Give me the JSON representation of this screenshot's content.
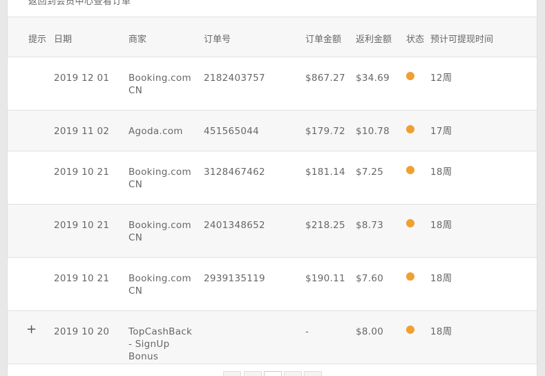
{
  "top_caption": "返回到会员中心查看订单",
  "table": {
    "headers": {
      "hint": "提示",
      "date": "日期",
      "merchant": "商家",
      "order": "订单号",
      "amount": "订单金额",
      "rebate": "返利金额",
      "status": "状态",
      "withdraw_time": "预计可提现时间"
    },
    "rows": [
      {
        "hint": "",
        "date": "2019 12 01",
        "merchant": "Booking.com CN",
        "order": "2182403757",
        "amount": "$867.27",
        "rebate": "$34.69",
        "weeks": "12周",
        "status_color": "#f0a030"
      },
      {
        "hint": "",
        "date": "2019 11 02",
        "merchant": "Agoda.com",
        "order": "451565044",
        "amount": "$179.72",
        "rebate": "$10.78",
        "weeks": "17周",
        "status_color": "#f0a030"
      },
      {
        "hint": "",
        "date": "2019 10 21",
        "merchant": "Booking.com CN",
        "order": "3128467462",
        "amount": "$181.14",
        "rebate": "$7.25",
        "weeks": "18周",
        "status_color": "#f0a030"
      },
      {
        "hint": "",
        "date": "2019 10 21",
        "merchant": "Booking.com CN",
        "order": "2401348652",
        "amount": "$218.25",
        "rebate": "$8.73",
        "weeks": "18周",
        "status_color": "#f0a030"
      },
      {
        "hint": "",
        "date": "2019 10 21",
        "merchant": "Booking.com CN",
        "order": "2939135119",
        "amount": "$190.11",
        "rebate": "$7.60",
        "weeks": "18周",
        "status_color": "#f0a030"
      },
      {
        "hint": "+",
        "date": "2019 10 20",
        "merchant": "TopCashBack - SignUp Bonus",
        "order": "",
        "amount": "-",
        "rebate": "$8.00",
        "weeks": "18周",
        "status_color": "#f0a030"
      }
    ]
  },
  "colors": {
    "status_pending": "#f0a030",
    "row_alt_bg": "#f7f7f7",
    "border": "#e2e2e2"
  }
}
